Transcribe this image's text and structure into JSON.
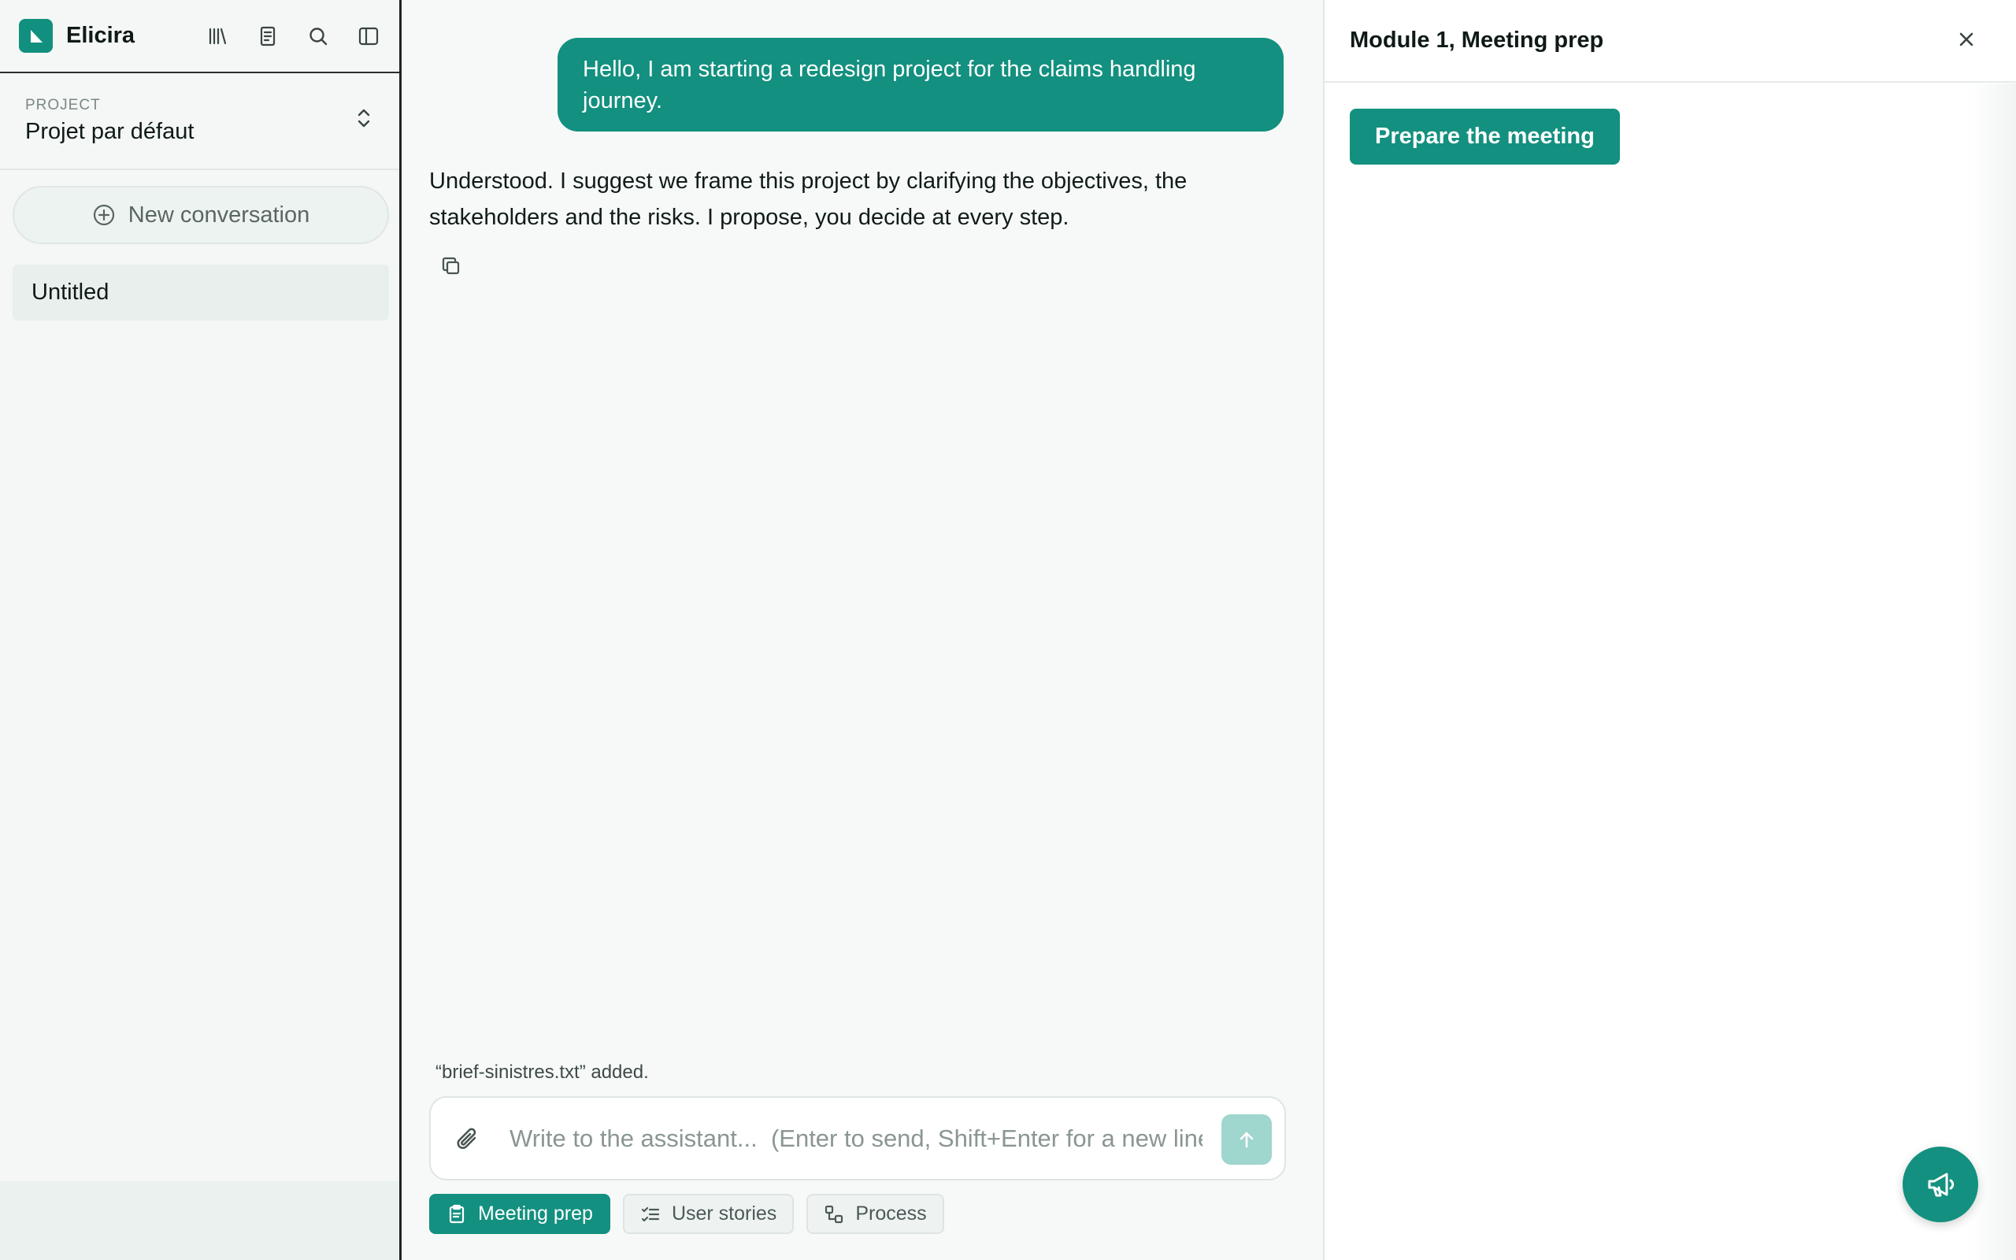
{
  "app": {
    "name": "Elicira"
  },
  "sidebar": {
    "icons": [
      "library-icon",
      "notes-icon",
      "search-icon",
      "sidebar-toggle-icon"
    ],
    "project_caption": "PROJECT",
    "project_name": "Projet par défaut",
    "new_conversation_label": "New conversation",
    "conversations": [
      {
        "title": "Untitled"
      }
    ]
  },
  "chat": {
    "user_message": "Hello, I am starting a redesign project for the claims handling journey.",
    "assistant_message": "Understood. I suggest we frame this project by clarifying the objectives, the stakeholders and the risks. I propose, you decide at every step.",
    "file_notice": "“brief-sinistres.txt” added.",
    "composer": {
      "placeholder": "Write to the assistant...  (Enter to send, Shift+Enter for a new line)",
      "value": ""
    },
    "modules": [
      {
        "label": "Meeting prep",
        "icon": "clipboard-icon",
        "active": true
      },
      {
        "label": "User stories",
        "icon": "checklist-icon",
        "active": false
      },
      {
        "label": "Process",
        "icon": "process-icon",
        "active": false
      }
    ]
  },
  "panel": {
    "title": "Module 1, Meeting prep",
    "primary_button": "Prepare the meeting"
  },
  "colors": {
    "accent": "#13907f",
    "send_disabled": "#9fd6cd",
    "background": "#f6f9f8"
  }
}
